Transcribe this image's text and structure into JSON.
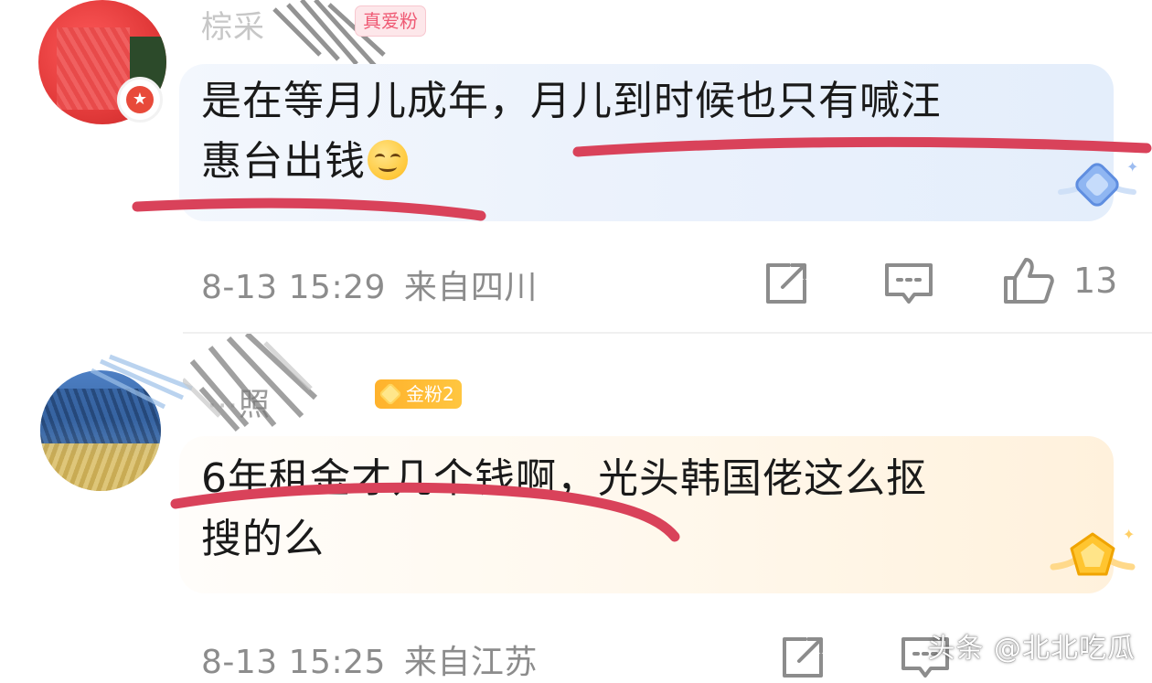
{
  "comments": [
    {
      "username": "棕采",
      "badge": "真爱粉",
      "text_line1": "是在等月儿成年，月儿到时候也只有喊汪",
      "text_line2": "惠台出钱",
      "time": "8-13 15:29",
      "location": "来自四川",
      "likes": "13"
    },
    {
      "username": "照",
      "badge": "金粉2",
      "text_line1": "6年租金才几个钱啊，光头韩国佬这么抠",
      "text_line2": "搜的么",
      "time": "8-13 15:25",
      "location": "来自江苏",
      "likes": ""
    }
  ],
  "watermark": "头条 @北北吃瓜",
  "colors": {
    "underline": "#d9425a",
    "meta_gray": "#8c8c8c",
    "bubble_blue": "#eaf1fc",
    "bubble_gold": "#fff4e2"
  },
  "icons": [
    "share-icon",
    "comment-icon",
    "like-icon",
    "crystal-badge-icon",
    "gold-badge-icon",
    "fan-badge-icon"
  ]
}
